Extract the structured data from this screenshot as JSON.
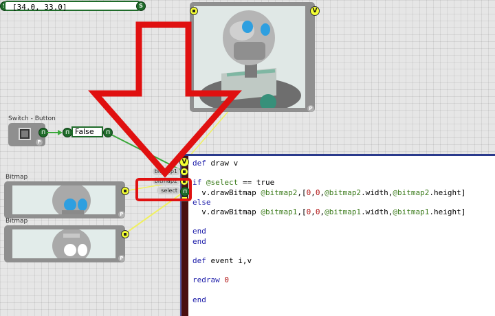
{
  "value_field": {
    "text": "[34.0, 33.0]"
  },
  "ports": {
    "s": "S",
    "v": "V",
    "p": "P",
    "t": "⊓"
  },
  "switch_module": {
    "title": "Switch - Button"
  },
  "bool_value": {
    "text": "False"
  },
  "bitmap_modules": [
    {
      "title": "Bitmap"
    },
    {
      "title": "Bitmap"
    }
  ],
  "inputs": {
    "bitmap1": "bitmap1",
    "bitmap2": "bitmap2",
    "select": "select"
  },
  "code_lines": [
    "def draw v",
    "",
    "if @select == true",
    "  v.drawBitmap @bitmap2,[0,0,@bitmap2.width,@bitmap2.height]",
    "else",
    "  v.drawBitmap @bitmap1,[0,0,@bitmap1.width,@bitmap1.height]",
    "",
    "end",
    "end",
    "",
    "def event i,v",
    "",
    "redraw 0",
    "",
    "end"
  ],
  "colors": {
    "link_green": "#3aa83a",
    "link_yellow": "#f0f060",
    "annotation_red": "#e01010"
  }
}
